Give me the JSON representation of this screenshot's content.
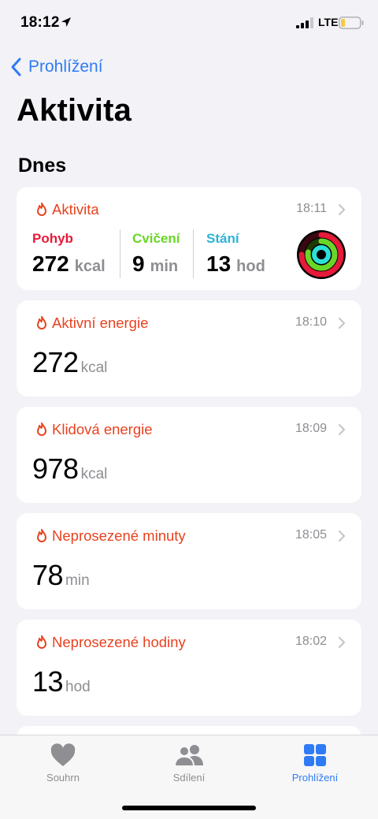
{
  "status_bar": {
    "time": "18:12",
    "network": "LTE"
  },
  "nav": {
    "back_label": "Prohlížení",
    "title": "Aktivita"
  },
  "section": {
    "title": "Dnes"
  },
  "activity_card": {
    "title": "Aktivita",
    "time": "18:11",
    "move": {
      "label": "Pohyb",
      "value": "272",
      "unit": "kcal",
      "color": "#e61a3a"
    },
    "exercise": {
      "label": "Cvičení",
      "value": "9",
      "unit": "min",
      "color": "#6ad628"
    },
    "stand": {
      "label": "Stání",
      "value": "13",
      "unit": "hod",
      "color": "#2cb3d8"
    }
  },
  "cards": [
    {
      "title": "Aktivní energie",
      "time": "18:10",
      "value": "272",
      "unit": "kcal"
    },
    {
      "title": "Klidová energie",
      "time": "18:09",
      "value": "978",
      "unit": "kcal"
    },
    {
      "title": "Neprosezené minuty",
      "time": "18:05",
      "value": "78",
      "unit": "min"
    },
    {
      "title": "Neprosezené hodiny",
      "time": "18:02",
      "value": "13",
      "unit": "hod"
    }
  ],
  "tabbar": {
    "summary": "Souhrn",
    "sharing": "Sdílení",
    "browse": "Prohlížení"
  },
  "colors": {
    "accent": "#2f7bf6",
    "category": "#e8421f"
  }
}
